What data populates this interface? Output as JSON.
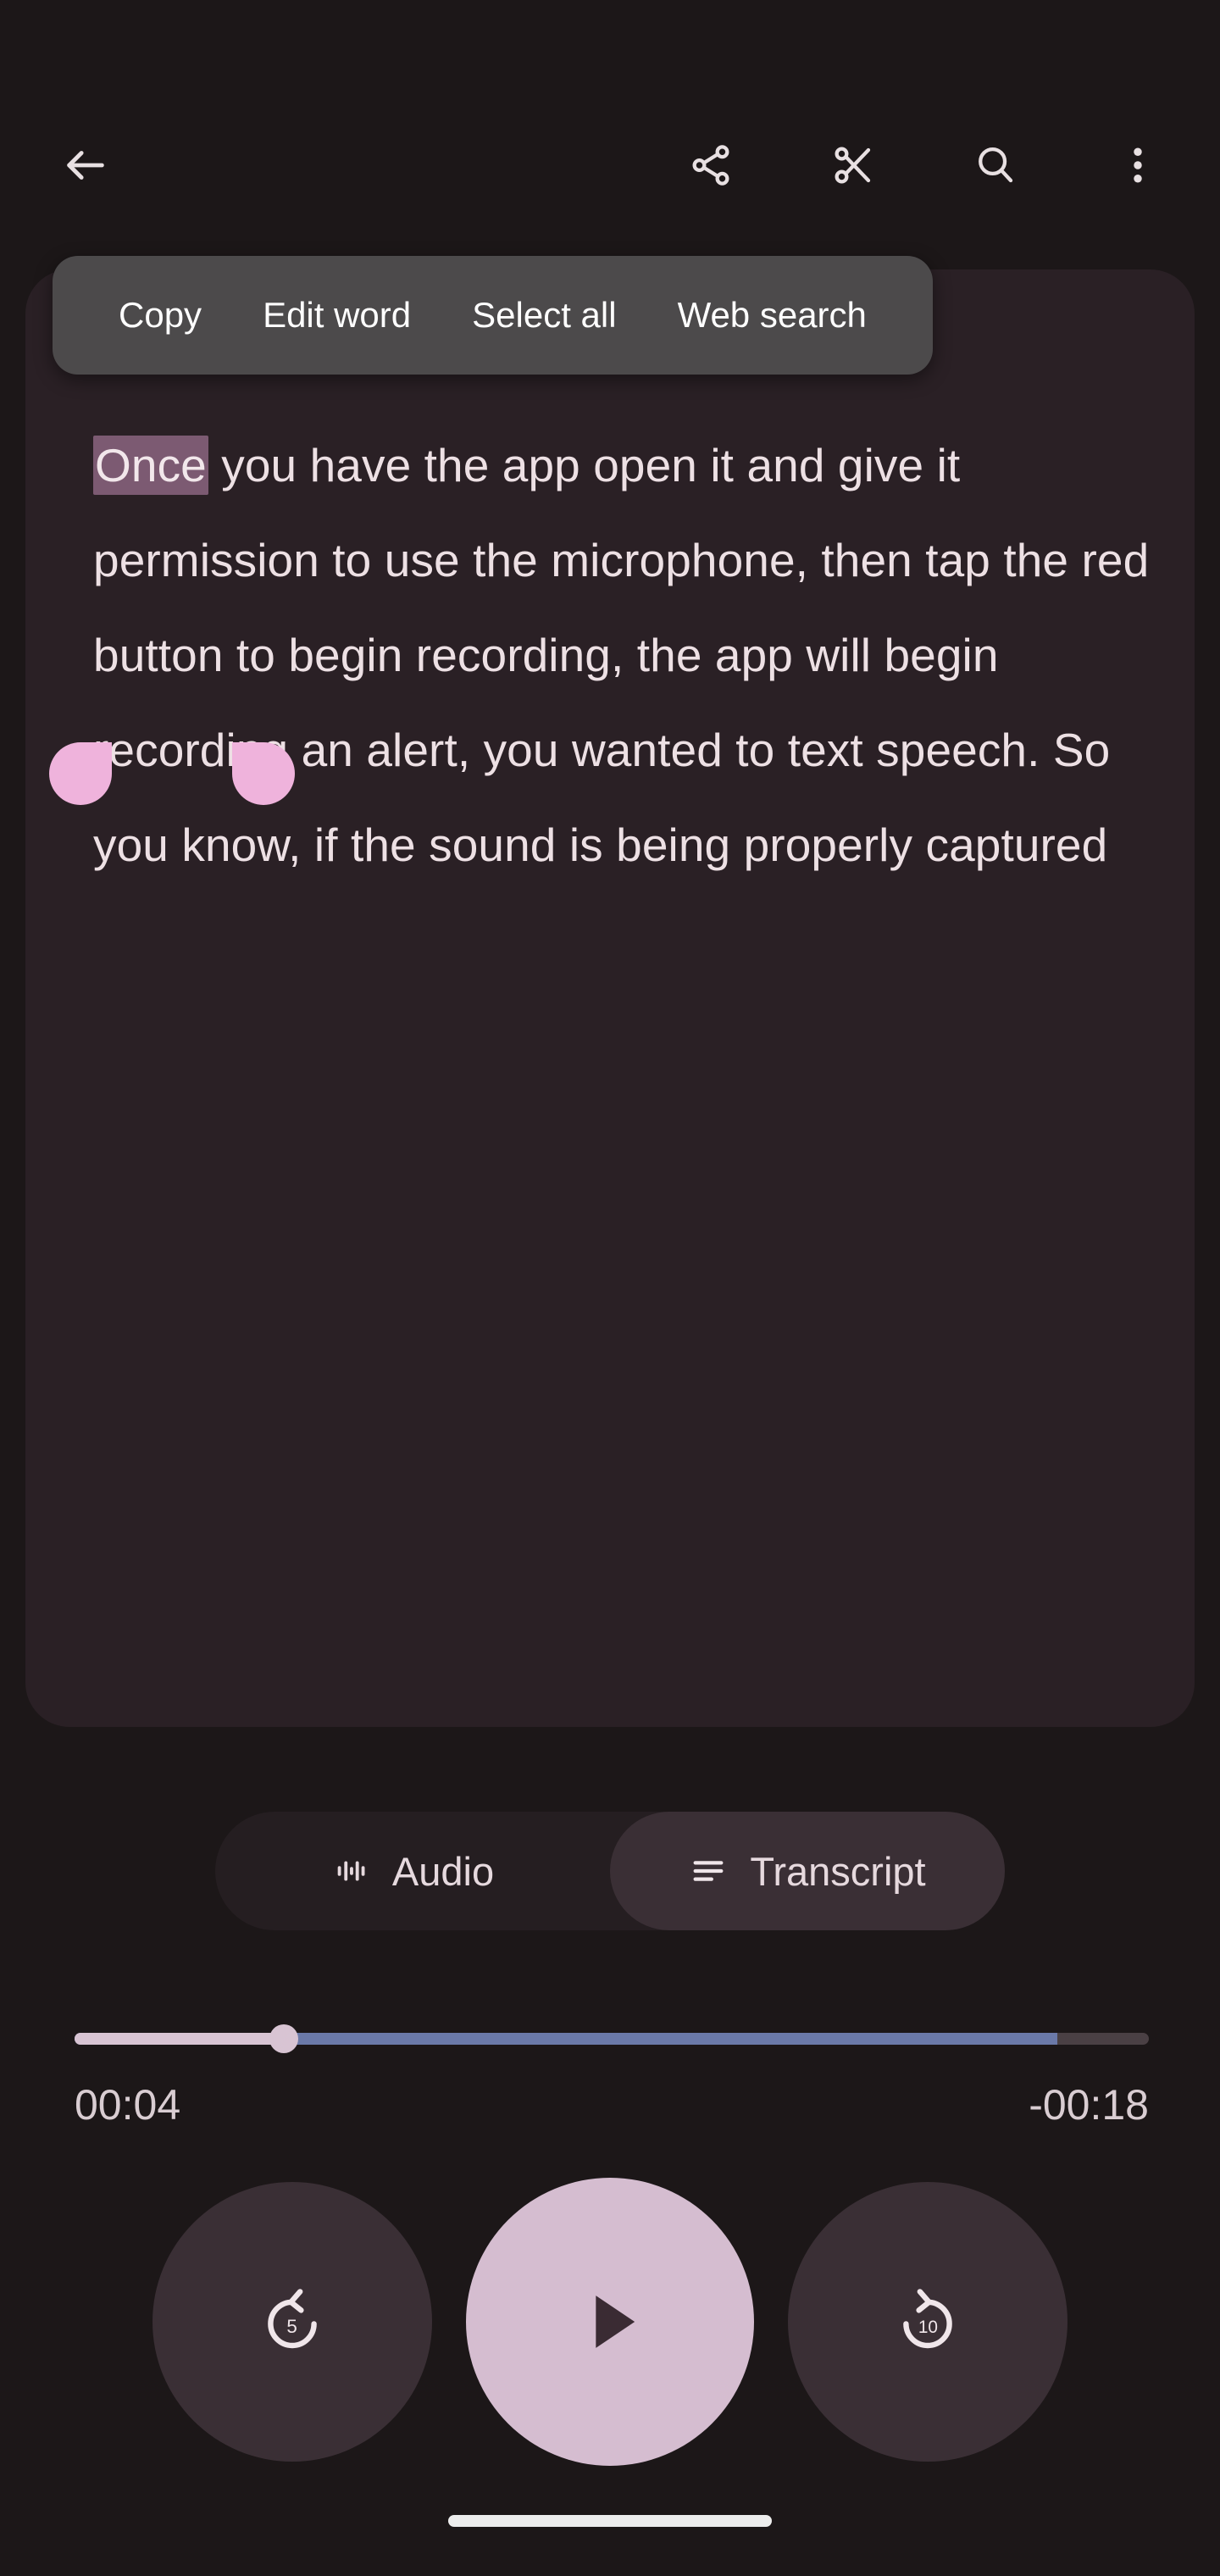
{
  "appbar": {
    "back_label": "Back",
    "actions": [
      {
        "name": "share-icon",
        "label": "Share"
      },
      {
        "name": "cut-icon",
        "label": "Trim"
      },
      {
        "name": "search-icon",
        "label": "Search"
      },
      {
        "name": "more-icon",
        "label": "More options"
      }
    ]
  },
  "context_menu": {
    "items": [
      {
        "label": "Copy"
      },
      {
        "label": "Edit word"
      },
      {
        "label": "Select all"
      },
      {
        "label": "Web search"
      }
    ]
  },
  "transcript": {
    "selected_word": "Once",
    "rest": " you have the app open it and give it permission to use the microphone, then tap the red button to begin recording, the app will begin recording an alert, you wanted to text speech. So you know, if the sound is being properly captured",
    "full_text": "Once you have the app open it and give it permission to use the microphone, then tap the red button to begin recording, the app will begin recording an alert, you wanted to text speech. So you know, if the sound is being properly captured",
    "lines": [
      "Once you have the app open it and give it",
      "permission to use the microphone, then tap the",
      "red button to begin recording, the app will",
      "begin recording an alert, you wanted to text",
      "speech. So you know, if the sound is being",
      "properly captured"
    ]
  },
  "tabs": {
    "audio_label": "Audio",
    "transcript_label": "Transcript",
    "active": "Transcript"
  },
  "player": {
    "elapsed": "00:04",
    "remaining": "-00:18",
    "progress_percent": 19.5,
    "buffered_percent": 91.5,
    "rewind_seconds": "5",
    "forward_seconds": "10",
    "play_label": "Play"
  },
  "colors": {
    "background": "#1C1718",
    "card": "#2A2025",
    "accent_pink": "#EFB3DC",
    "play_button": "#D5BDD0",
    "selection_highlight": "#7C5A72",
    "buffered": "#6B79A8",
    "played": "#D8C4D3",
    "menu_surface": "#4C4A4B"
  }
}
